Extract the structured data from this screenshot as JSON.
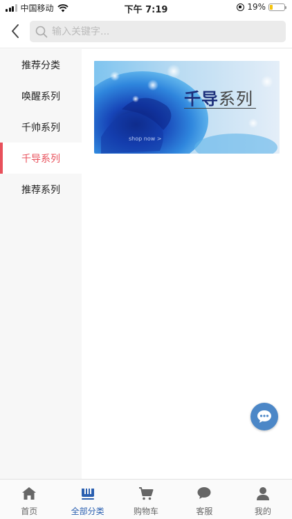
{
  "status_bar": {
    "carrier": "中国移动",
    "time": "下午 7:19",
    "battery": "19%",
    "battery_level": 0.19
  },
  "header": {
    "search_placeholder": "输入关键字..."
  },
  "sidebar": {
    "items": [
      {
        "label": "推荐分类"
      },
      {
        "label": "唤醒系列"
      },
      {
        "label": "千帅系列"
      },
      {
        "label": "千导系列"
      },
      {
        "label": "推荐系列"
      }
    ],
    "active_index": 3,
    "accent_color": "#e8505b"
  },
  "banner": {
    "title_bold": "千导",
    "title_rest": "系列",
    "shop_text": "shop now >"
  },
  "tabbar": {
    "items": [
      {
        "label": "首页",
        "icon": "home-icon"
      },
      {
        "label": "全部分类",
        "icon": "category-icon"
      },
      {
        "label": "购物车",
        "icon": "cart-icon"
      },
      {
        "label": "客服",
        "icon": "chat-icon"
      },
      {
        "label": "我的",
        "icon": "user-icon"
      }
    ],
    "active_index": 1,
    "active_color": "#2a5fb0"
  }
}
